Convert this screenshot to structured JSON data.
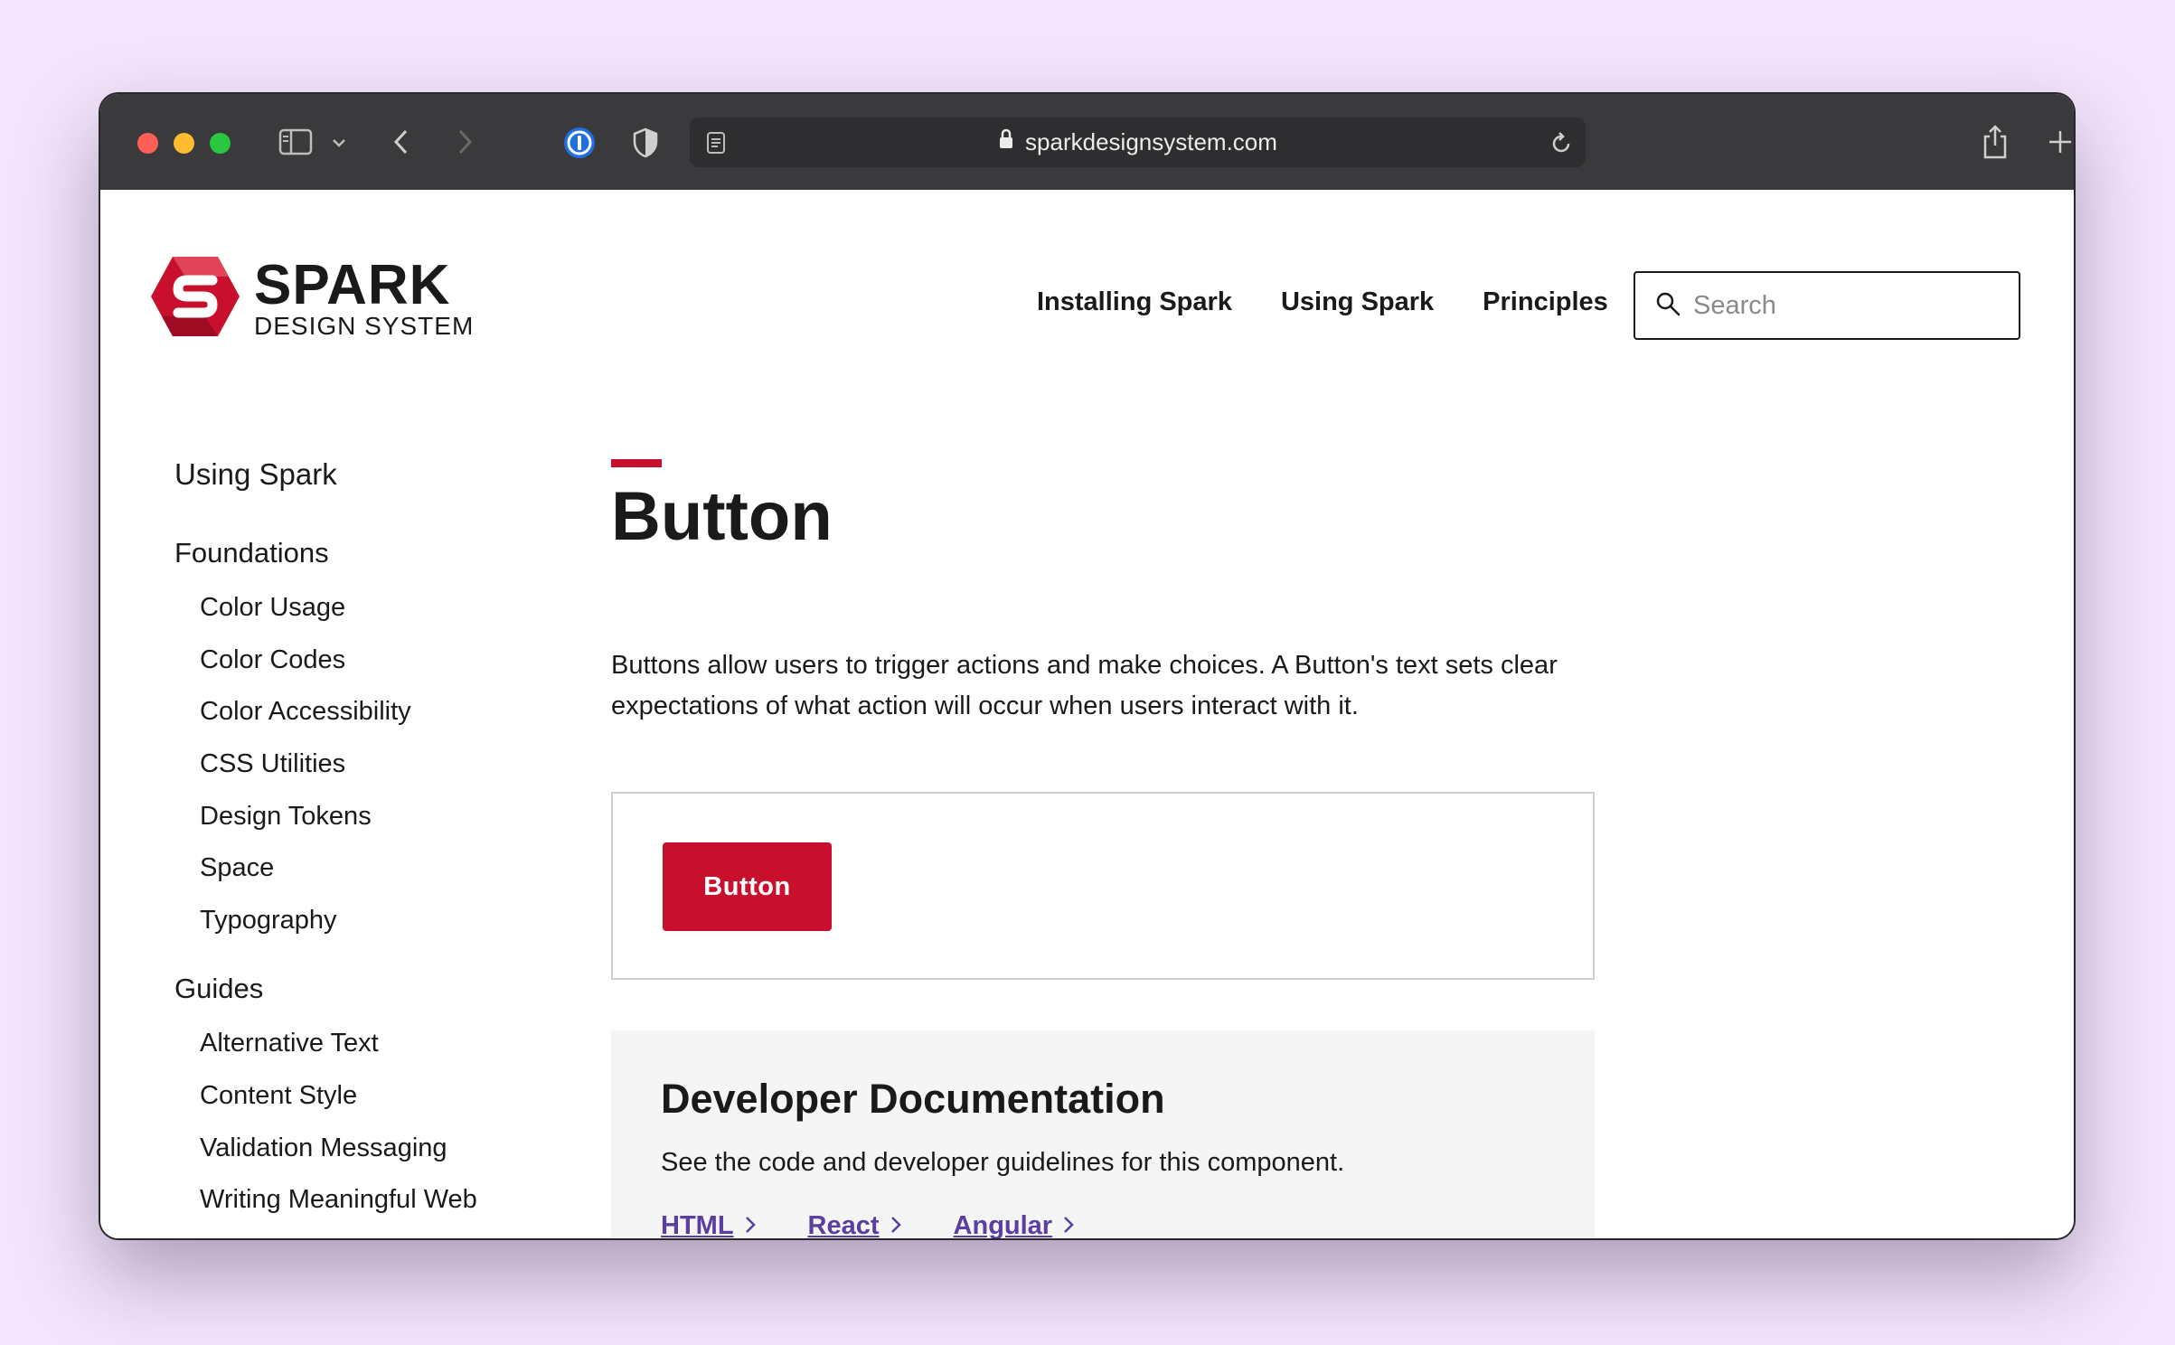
{
  "browser": {
    "url": "sparkdesignsystem.com"
  },
  "brand": {
    "name": "SPARK",
    "tagline": "DESIGN SYSTEM",
    "color": "#c8102e"
  },
  "topnav": {
    "items": [
      {
        "label": "Installing Spark"
      },
      {
        "label": "Using Spark"
      },
      {
        "label": "Principles"
      }
    ],
    "search_placeholder": "Search"
  },
  "sidebar": {
    "title": "Using Spark",
    "sections": [
      {
        "label": "Foundations",
        "items": [
          "Color Usage",
          "Color Codes",
          "Color Accessibility",
          "CSS Utilities",
          "Design Tokens",
          "Space",
          "Typography"
        ]
      },
      {
        "label": "Guides",
        "items": [
          "Alternative Text",
          "Content Style",
          "Validation Messaging",
          "Writing Meaningful Web"
        ]
      }
    ]
  },
  "main": {
    "title": "Button",
    "intro": "Buttons allow users to trigger actions and make choices. A Button's text sets clear expectations of what action will occur when users interact with it.",
    "demo_button_label": "Button",
    "dev_doc": {
      "title": "Developer Documentation",
      "description": "See the code and developer guidelines for this component.",
      "links": [
        "HTML",
        "React",
        "Angular"
      ]
    }
  }
}
